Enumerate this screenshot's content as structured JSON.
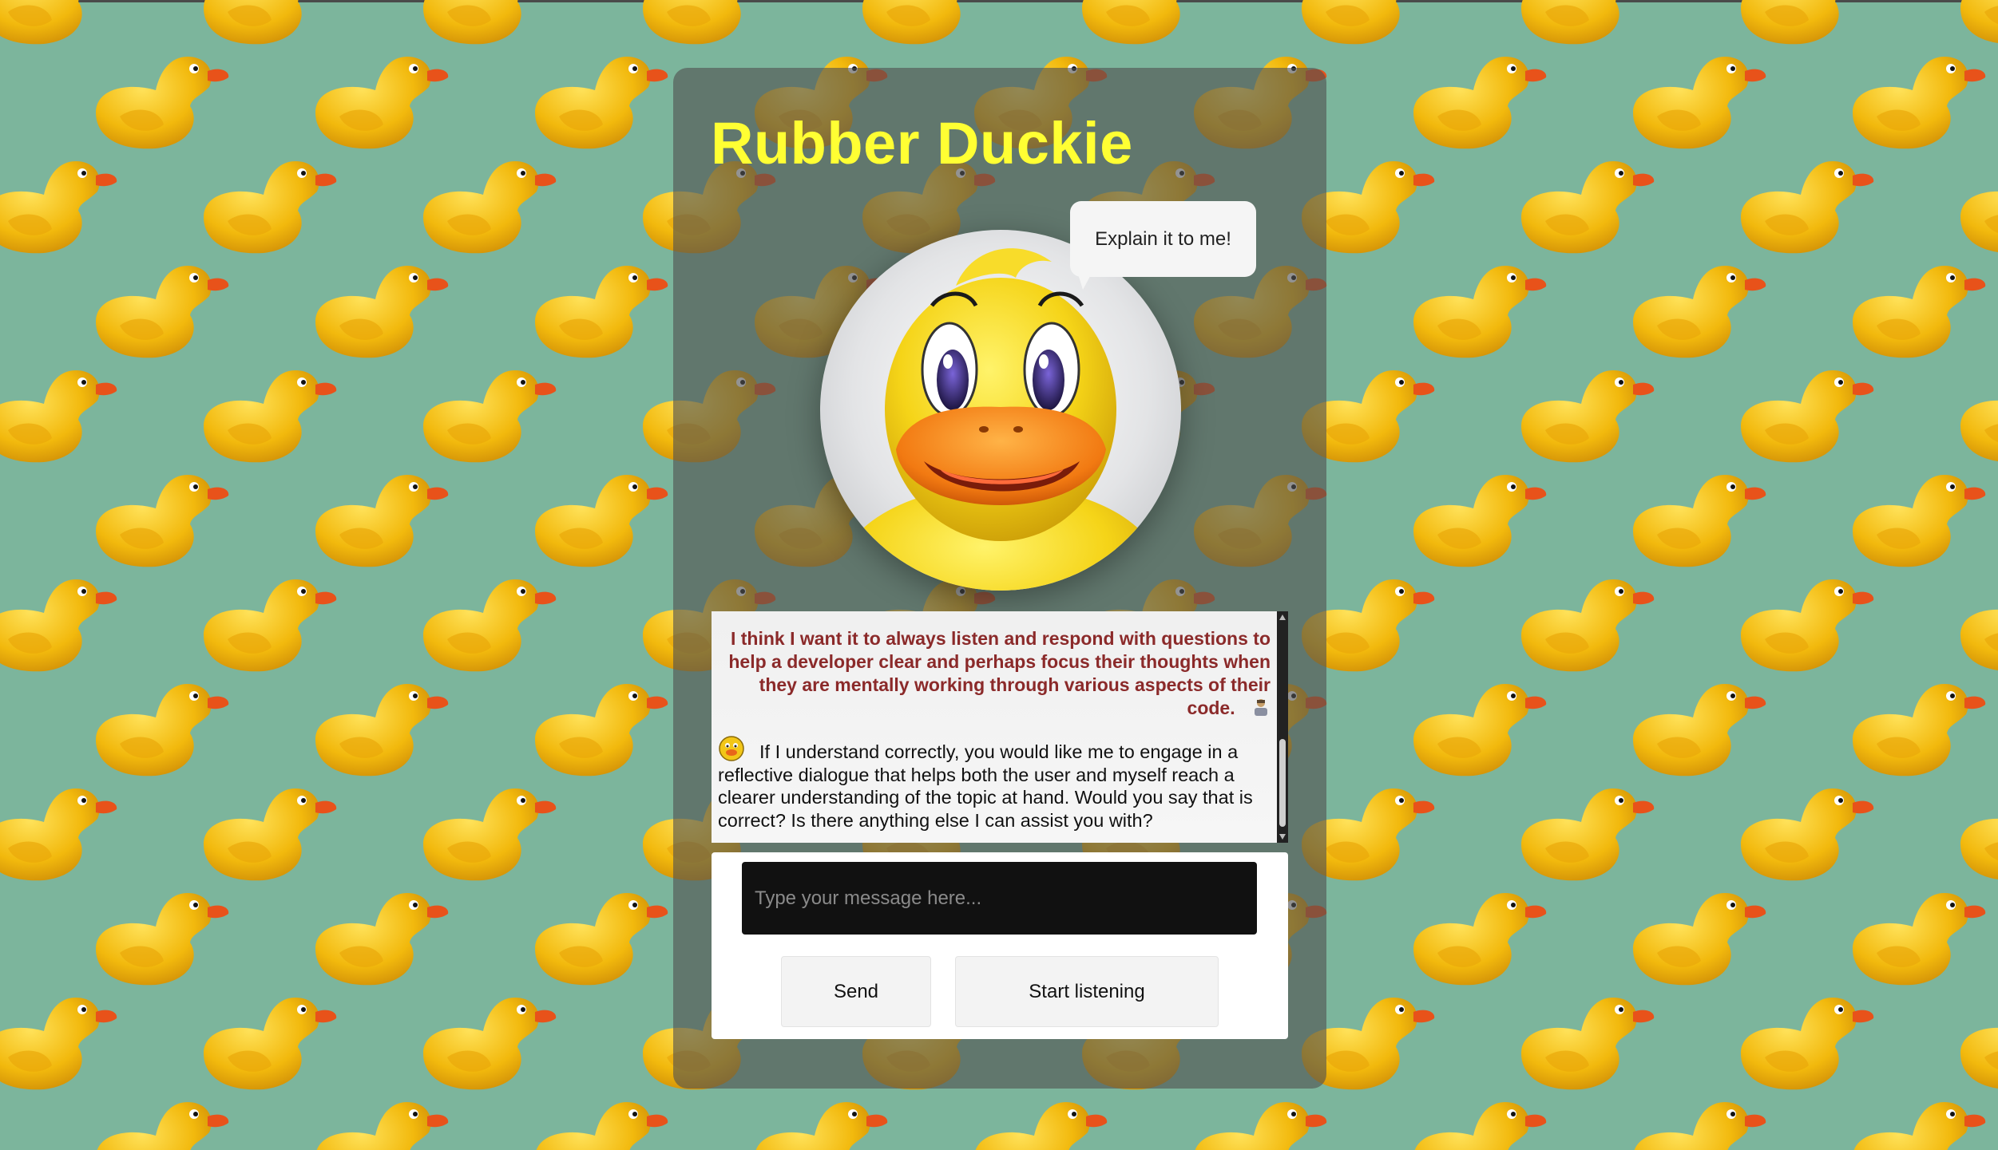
{
  "app": {
    "title": "Rubber Duckie"
  },
  "duck": {
    "speech_bubble": "Explain it to me!",
    "avatar_icon": "rubber-duck-face"
  },
  "chat": {
    "messages": [
      {
        "role": "user",
        "text": "I think I want it to always listen and respond with questions to help a developer clear and perhaps focus their thoughts when they are mentally working through various aspects of their code.",
        "icon": "person-icon"
      },
      {
        "role": "assistant",
        "text": "If I understand correctly, you would like me to engage in a reflective dialogue that helps both the user and myself reach a clearer understanding of the topic at hand. Would you say that is correct? Is there anything else I can assist you with?",
        "icon": "duck-face-icon"
      }
    ]
  },
  "composer": {
    "placeholder": "Type your message here...",
    "value": "",
    "send_label": "Send",
    "listen_label": "Start listening"
  },
  "colors": {
    "background": "#7cb59c",
    "title": "#ffff33",
    "user_text": "#8b2a2a",
    "input_bg": "#111111"
  }
}
